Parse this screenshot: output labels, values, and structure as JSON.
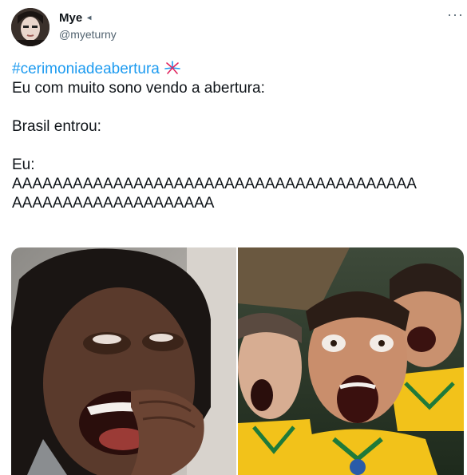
{
  "author": {
    "display_name": "Mye",
    "badge": "◂",
    "handle": "@myeturny",
    "avatar": "user-avatar"
  },
  "more_label": "···",
  "tweet": {
    "hashtag": "#cerimoniadeabertura",
    "hashtag_emoji": "fireworks-emoji",
    "line1": "Eu com muito sono vendo a abertura:",
    "line2": "Brasil entrou:",
    "line3": "Eu:",
    "line4": "AAAAAAAAAAAAAAAAAAAAAAAAAAAAAAAAAAAAAAAA",
    "line5": "AAAAAAAAAAAAAAAAAAAA"
  },
  "media": [
    {
      "name": "image-screaming-woman"
    },
    {
      "name": "image-screaming-fans"
    }
  ],
  "colors": {
    "link": "#1d9bf0",
    "text": "#0f1419",
    "secondary": "#536471",
    "brazil_yellow": "#f2c21a",
    "brazil_green": "#1f7a3a"
  }
}
